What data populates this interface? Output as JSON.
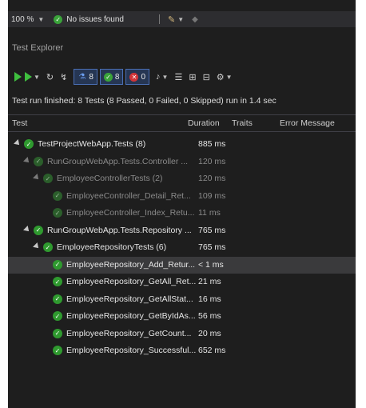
{
  "status_bar": {
    "zoom": "100 %",
    "issues": "No issues found"
  },
  "panel": {
    "title": "Test Explorer"
  },
  "toolbar": {
    "total_count": "8",
    "passed_count": "8",
    "failed_count": "0"
  },
  "summary": "Test run finished: 8 Tests (8 Passed, 0 Failed, 0 Skipped) run in 1.4 sec",
  "columns": {
    "test": "Test",
    "duration": "Duration",
    "traits": "Traits",
    "error": "Error Message"
  },
  "rows": [
    {
      "name": "TestProjectWebApp.Tests (8)",
      "duration": "885 ms",
      "level": 0,
      "expanded": true,
      "dim": false,
      "selected": false
    },
    {
      "name": "RunGroupWebApp.Tests.Controller ...",
      "duration": "120 ms",
      "level": 1,
      "expanded": true,
      "dim": true,
      "selected": false
    },
    {
      "name": "EmployeeControllerTests (2)",
      "duration": "120 ms",
      "level": 2,
      "expanded": true,
      "dim": true,
      "selected": false
    },
    {
      "name": "EmployeeController_Detail_Ret...",
      "duration": "109 ms",
      "level": 3,
      "expanded": false,
      "dim": true,
      "selected": false
    },
    {
      "name": "EmployeeController_Index_Retu...",
      "duration": "11 ms",
      "level": 3,
      "expanded": false,
      "dim": true,
      "selected": false
    },
    {
      "name": "RunGroupWebApp.Tests.Repository ...",
      "duration": "765 ms",
      "level": 1,
      "expanded": true,
      "dim": false,
      "selected": false
    },
    {
      "name": "EmployeeRepositoryTests (6)",
      "duration": "765 ms",
      "level": 2,
      "expanded": true,
      "dim": false,
      "selected": false
    },
    {
      "name": "EmployeeRepository_Add_Retur...",
      "duration": "< 1 ms",
      "level": 3,
      "expanded": false,
      "dim": false,
      "selected": true
    },
    {
      "name": "EmployeeRepository_GetAll_Ret...",
      "duration": "21 ms",
      "level": 3,
      "expanded": false,
      "dim": false,
      "selected": false
    },
    {
      "name": "EmployeeRepository_GetAllStat...",
      "duration": "16 ms",
      "level": 3,
      "expanded": false,
      "dim": false,
      "selected": false
    },
    {
      "name": "EmployeeRepository_GetByIdAs...",
      "duration": "56 ms",
      "level": 3,
      "expanded": false,
      "dim": false,
      "selected": false
    },
    {
      "name": "EmployeeRepository_GetCount...",
      "duration": "20 ms",
      "level": 3,
      "expanded": false,
      "dim": false,
      "selected": false
    },
    {
      "name": "EmployeeRepository_Successful...",
      "duration": "652 ms",
      "level": 3,
      "expanded": false,
      "dim": false,
      "selected": false
    }
  ],
  "colors": {
    "background": "#1e1e1e",
    "passed": "#3aa33a",
    "failed": "#d13438",
    "selection": "#3a3a3c"
  }
}
